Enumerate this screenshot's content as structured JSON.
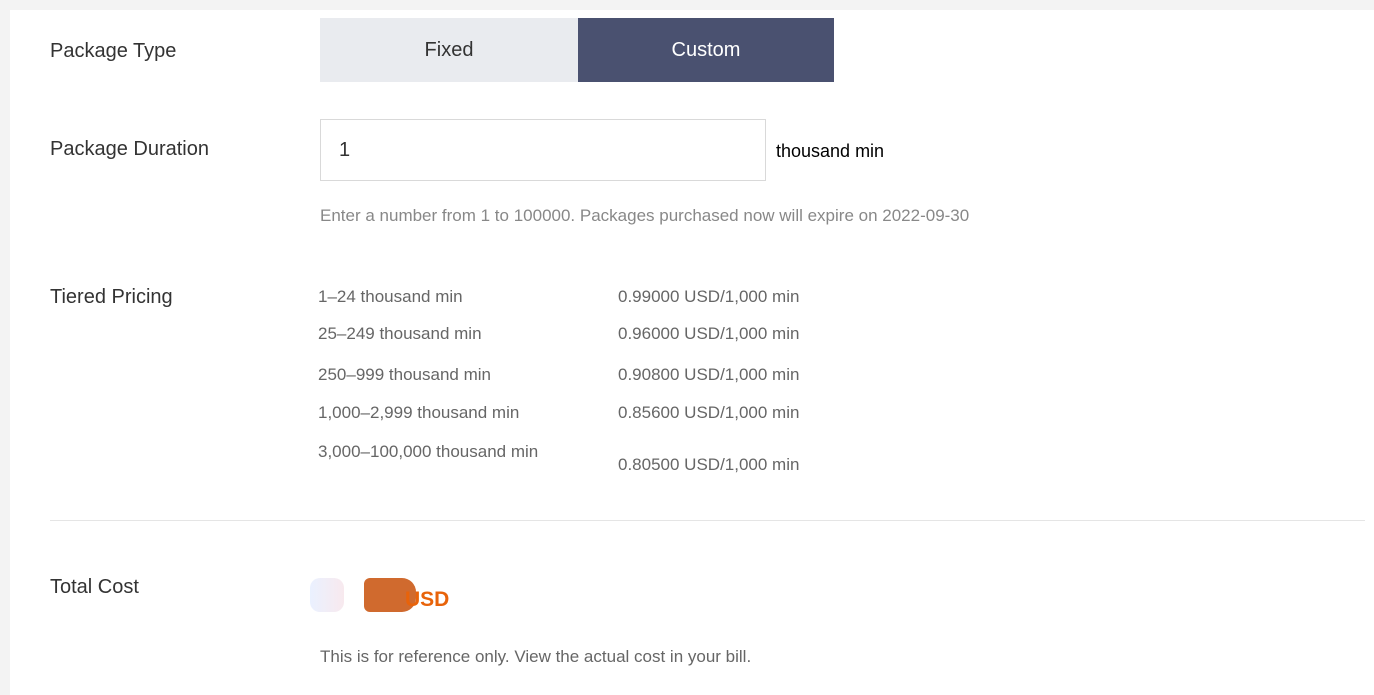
{
  "package_type": {
    "label": "Package Type",
    "options": [
      "Fixed",
      "Custom"
    ],
    "selected": "Custom"
  },
  "package_duration": {
    "label": "Package Duration",
    "value": "1",
    "unit": "thousand min",
    "hint": "Enter a number from 1 to 100000. Packages purchased now will expire on 2022-09-30"
  },
  "tiered_pricing": {
    "label": "Tiered Pricing",
    "tiers": [
      {
        "range": "1–24 thousand min",
        "price": "0.99000 USD/1,000 min"
      },
      {
        "range": "25–249 thousand min",
        "price": "0.96000 USD/1,000 min"
      },
      {
        "range": "250–999 thousand min",
        "price": "0.90800 USD/1,000 min"
      },
      {
        "range": "1,000–2,999 thousand min",
        "price": "0.85600 USD/1,000 min"
      },
      {
        "range": "3,000–100,000 thousand min",
        "price": "0.80500 USD/1,000 min"
      }
    ]
  },
  "total_cost": {
    "label": "Total Cost",
    "currency": "USD",
    "note": "This is for reference only. View the actual cost in your bill."
  },
  "colors": {
    "segment_selected": "#4a5170",
    "segment_unselected": "#e9ebef",
    "cost_accent": "#e8630a"
  }
}
